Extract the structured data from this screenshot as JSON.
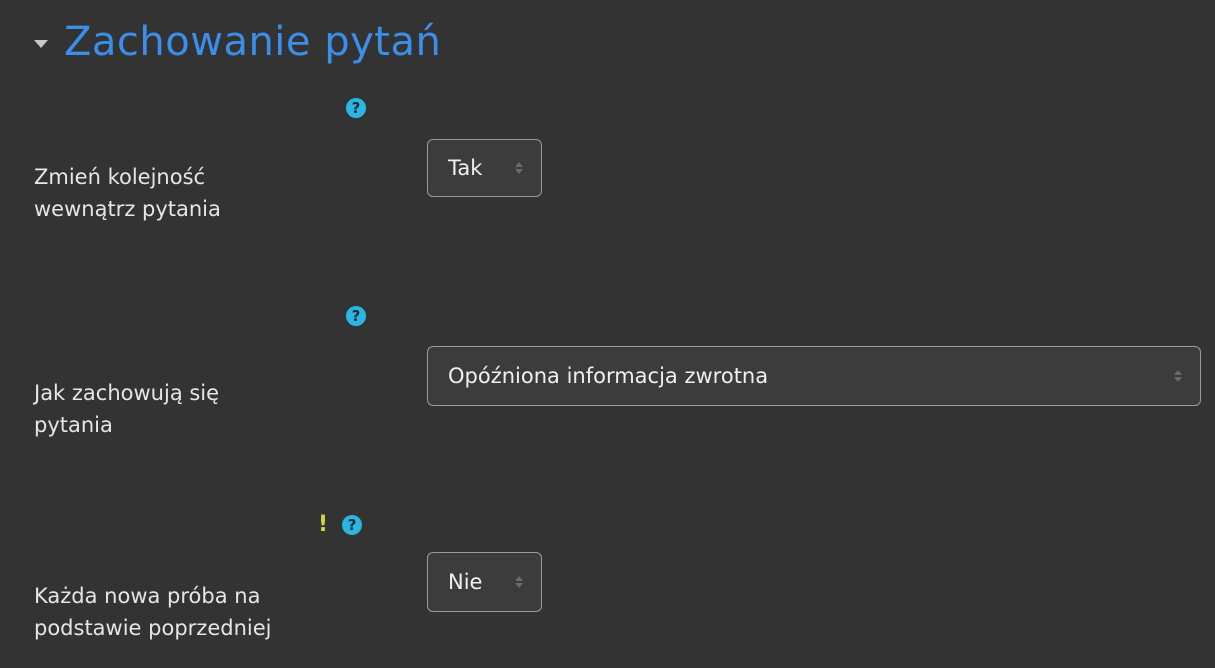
{
  "section": {
    "title": "Zachowanie pytań",
    "expanded": true
  },
  "fields": [
    {
      "label_line1": "Zmień kolejność",
      "label_line2": "wewnątrz pytania",
      "value": "Tak",
      "help": "?",
      "advanced": false
    },
    {
      "label_line1": "Jak zachowują się",
      "label_line2": "pytania",
      "value": "Opóźniona informacja zwrotna",
      "help": "?",
      "advanced": false
    },
    {
      "label_line1": "Każda nowa próba na",
      "label_line2": "podstawie poprzedniej",
      "value": "Nie",
      "help": "?",
      "advanced": true,
      "advanced_mark": "!"
    }
  ],
  "colors": {
    "background": "#333333",
    "accent": "#3b8eea",
    "help": "#29b6e3",
    "advanced": "#d7d23b"
  }
}
